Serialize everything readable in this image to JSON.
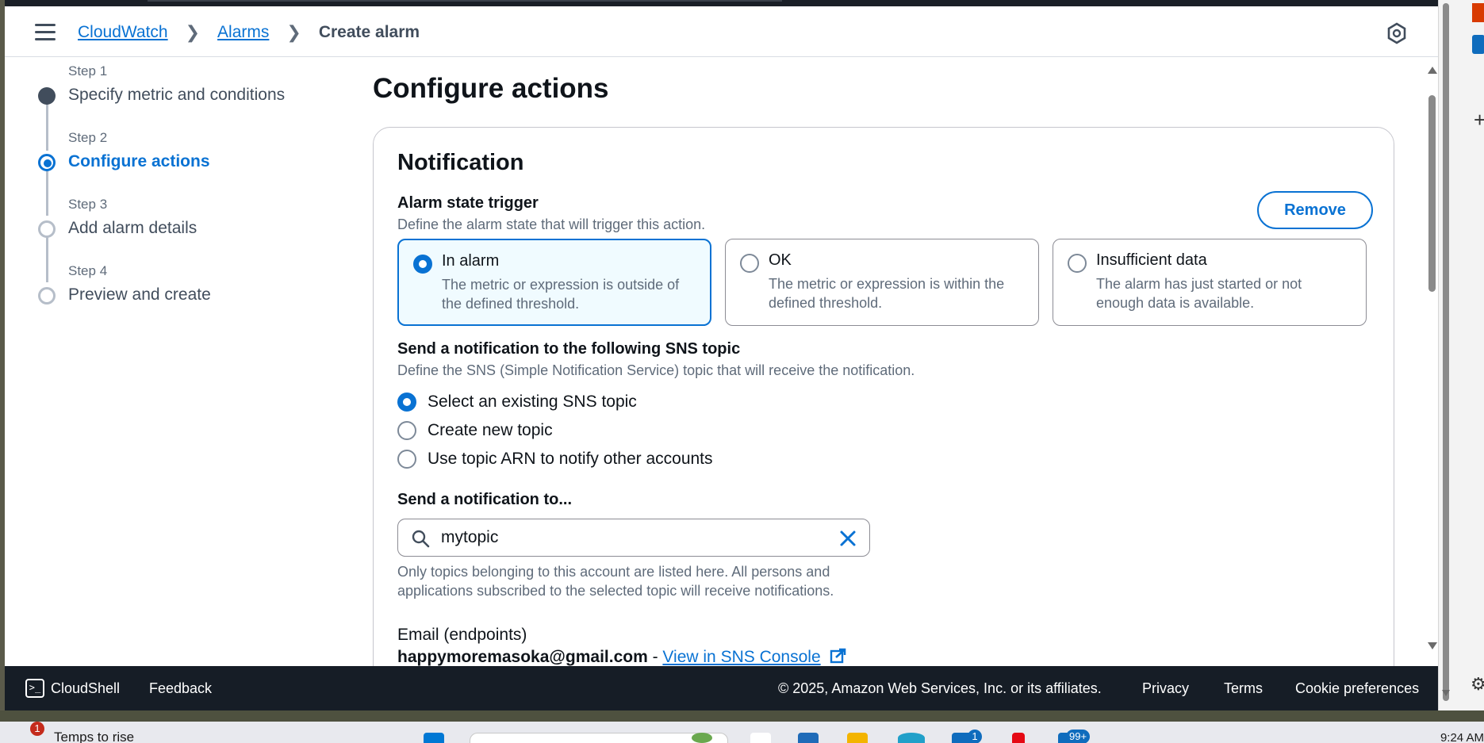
{
  "breadcrumb": {
    "items": [
      {
        "label": "CloudWatch"
      },
      {
        "label": "Alarms"
      }
    ],
    "current": "Create alarm"
  },
  "steps": [
    {
      "number": "Step 1",
      "label": "Specify metric and conditions",
      "state": "done"
    },
    {
      "number": "Step 2",
      "label": "Configure actions",
      "state": "active"
    },
    {
      "number": "Step 3",
      "label": "Add alarm details",
      "state": "todo"
    },
    {
      "number": "Step 4",
      "label": "Preview and create",
      "state": "todo"
    }
  ],
  "main": {
    "title": "Configure actions",
    "notification": {
      "title": "Notification",
      "remove_label": "Remove",
      "trigger_label": "Alarm state trigger",
      "trigger_desc": "Define the alarm state that will trigger this action.",
      "states": [
        {
          "title": "In alarm",
          "desc": "The metric or expression is outside of the defined threshold.",
          "selected": true
        },
        {
          "title": "OK",
          "desc": "The metric or expression is within the defined threshold.",
          "selected": false
        },
        {
          "title": "Insufficient data",
          "desc": "The alarm has just started or not enough data is available.",
          "selected": false
        }
      ],
      "sns_label": "Send a notification to the following SNS topic",
      "sns_desc": "Define the SNS (Simple Notification Service) topic that will receive the notification.",
      "sns_options": [
        {
          "label": "Select an existing SNS topic",
          "selected": true
        },
        {
          "label": "Create new topic",
          "selected": false
        },
        {
          "label": "Use topic ARN to notify other accounts",
          "selected": false
        }
      ],
      "send_to_label": "Send a notification to...",
      "search_value": "mytopic",
      "search_help": "Only topics belonging to this account are listed here. All persons and applications subscribed to the selected topic will receive notifications.",
      "endpoints_label": "Email (endpoints)",
      "endpoint_email": "happymoremasoka@gmail.com",
      "endpoint_sep": " - ",
      "endpoint_link": "View in SNS Console"
    }
  },
  "footer": {
    "cloudshell": "CloudShell",
    "feedback": "Feedback",
    "copyright": "© 2025, Amazon Web Services, Inc. or its affiliates.",
    "privacy": "Privacy",
    "terms": "Terms",
    "cookies": "Cookie preferences"
  },
  "taskbar": {
    "weather_text": "Temps to rise",
    "weather_badge": "1",
    "mail_badge": "1",
    "store_badge": "99+",
    "clock": "9:24 AM"
  },
  "colors": {
    "accent": "#0972d3",
    "text": "#0f141a",
    "muted": "#5f6b7a",
    "footer_bg": "#161d26"
  }
}
